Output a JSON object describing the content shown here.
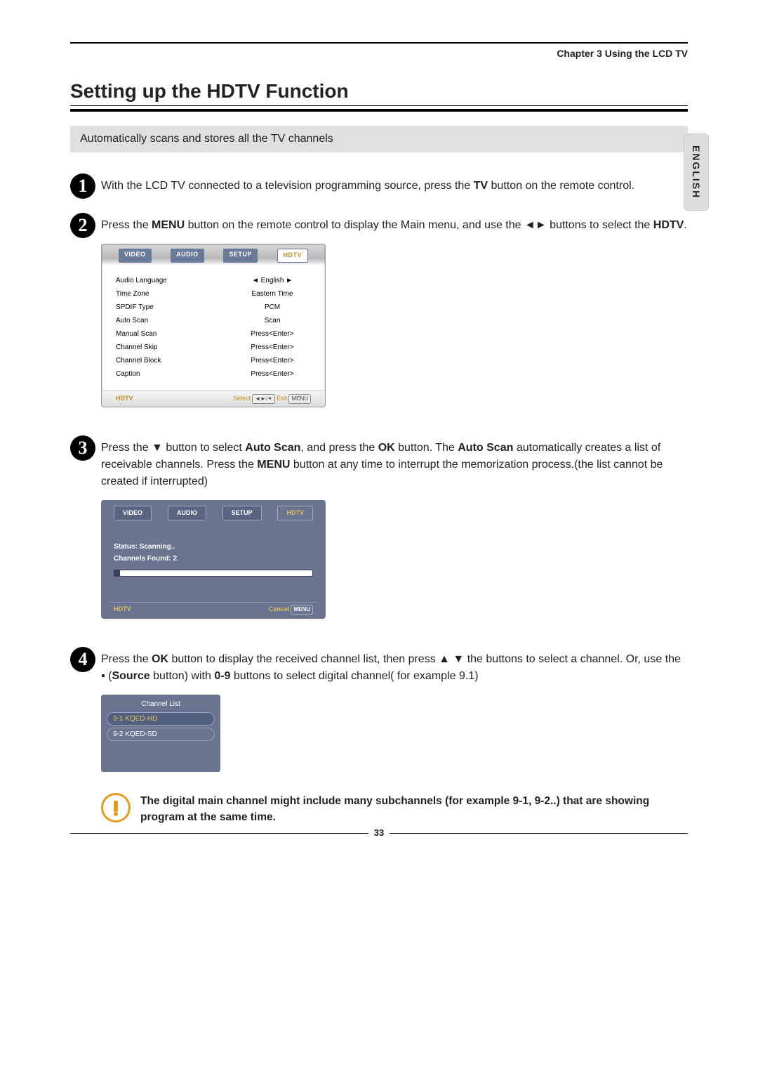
{
  "chapter": "Chapter 3 Using the LCD TV",
  "side_tab": "ENGLISH",
  "title": "Setting up the HDTV Function",
  "intro": "Automatically scans and stores all the TV channels",
  "steps": {
    "s1": {
      "text_a": "With the LCD TV connected to a television programming source, press the ",
      "b1": "TV",
      "text_b": " button on the remote control."
    },
    "s2": {
      "text_a": "Press the ",
      "b1": "MENU",
      "text_b": " button on the remote control to display the Main menu, and use the  ◄►  buttons to select the ",
      "b2": "HDTV",
      "text_c": "."
    },
    "s3": {
      "text_a": "Press the  ▼  button to select ",
      "b1": "Auto Scan",
      "text_b": ", and press the ",
      "b2": "OK",
      "text_c": " button. The ",
      "b3": "Auto Scan",
      "text_d": " automatically creates a list of receivable channels. Press the ",
      "b4": "MENU",
      "text_e": " button at any time to interrupt the memorization process.(the list cannot be created if interrupted)"
    },
    "s4": {
      "text_a": "Press the ",
      "b1": "OK",
      "text_b": " button to display the received channel list, then press  ▲ ▼ the buttons to select a channel. Or, use the ▪ (",
      "b2": "Source",
      "text_c": " button) with ",
      "b3": "0-9",
      "text_d": " buttons to select digital channel( for example 9.1)"
    }
  },
  "osd1": {
    "tabs": [
      "VIDEO",
      "AUDIO",
      "SETUP",
      "HDTV"
    ],
    "rows": [
      {
        "l": "Audio Language",
        "r": "◄     English     ►"
      },
      {
        "l": "Time Zone",
        "r": "Eastern Time"
      },
      {
        "l": "SPDIF Type",
        "r": "PCM"
      },
      {
        "l": "Auto Scan",
        "r": "Scan"
      },
      {
        "l": "Manual Scan",
        "r": "Press<Enter>"
      },
      {
        "l": "Channel Skip",
        "r": "Press<Enter>"
      },
      {
        "l": "Channel Block",
        "r": "Press<Enter>"
      },
      {
        "l": "Caption",
        "r": "Press<Enter>"
      }
    ],
    "footer_left": "HDTV",
    "footer_select": "Select",
    "footer_btn1": "◄►/✦",
    "footer_exit": "Exit",
    "footer_btn2": "MENU"
  },
  "osd2": {
    "tabs": [
      "VIDEO",
      "AUDIO",
      "SETUP",
      "HDTV"
    ],
    "status": "Status: Scanning..",
    "found": "Channels Found: 2",
    "footer_left": "HDTV",
    "footer_cancel": "Cancel",
    "footer_btn": "MENU"
  },
  "clist": {
    "title": "Channel List",
    "rows": [
      "9-1 KQED-HD",
      "9-2 KQED-SD"
    ]
  },
  "warning": "The digital main channel might include many subchannels (for example 9-1, 9-2..) that are showing program at the same time.",
  "page_number": "33"
}
